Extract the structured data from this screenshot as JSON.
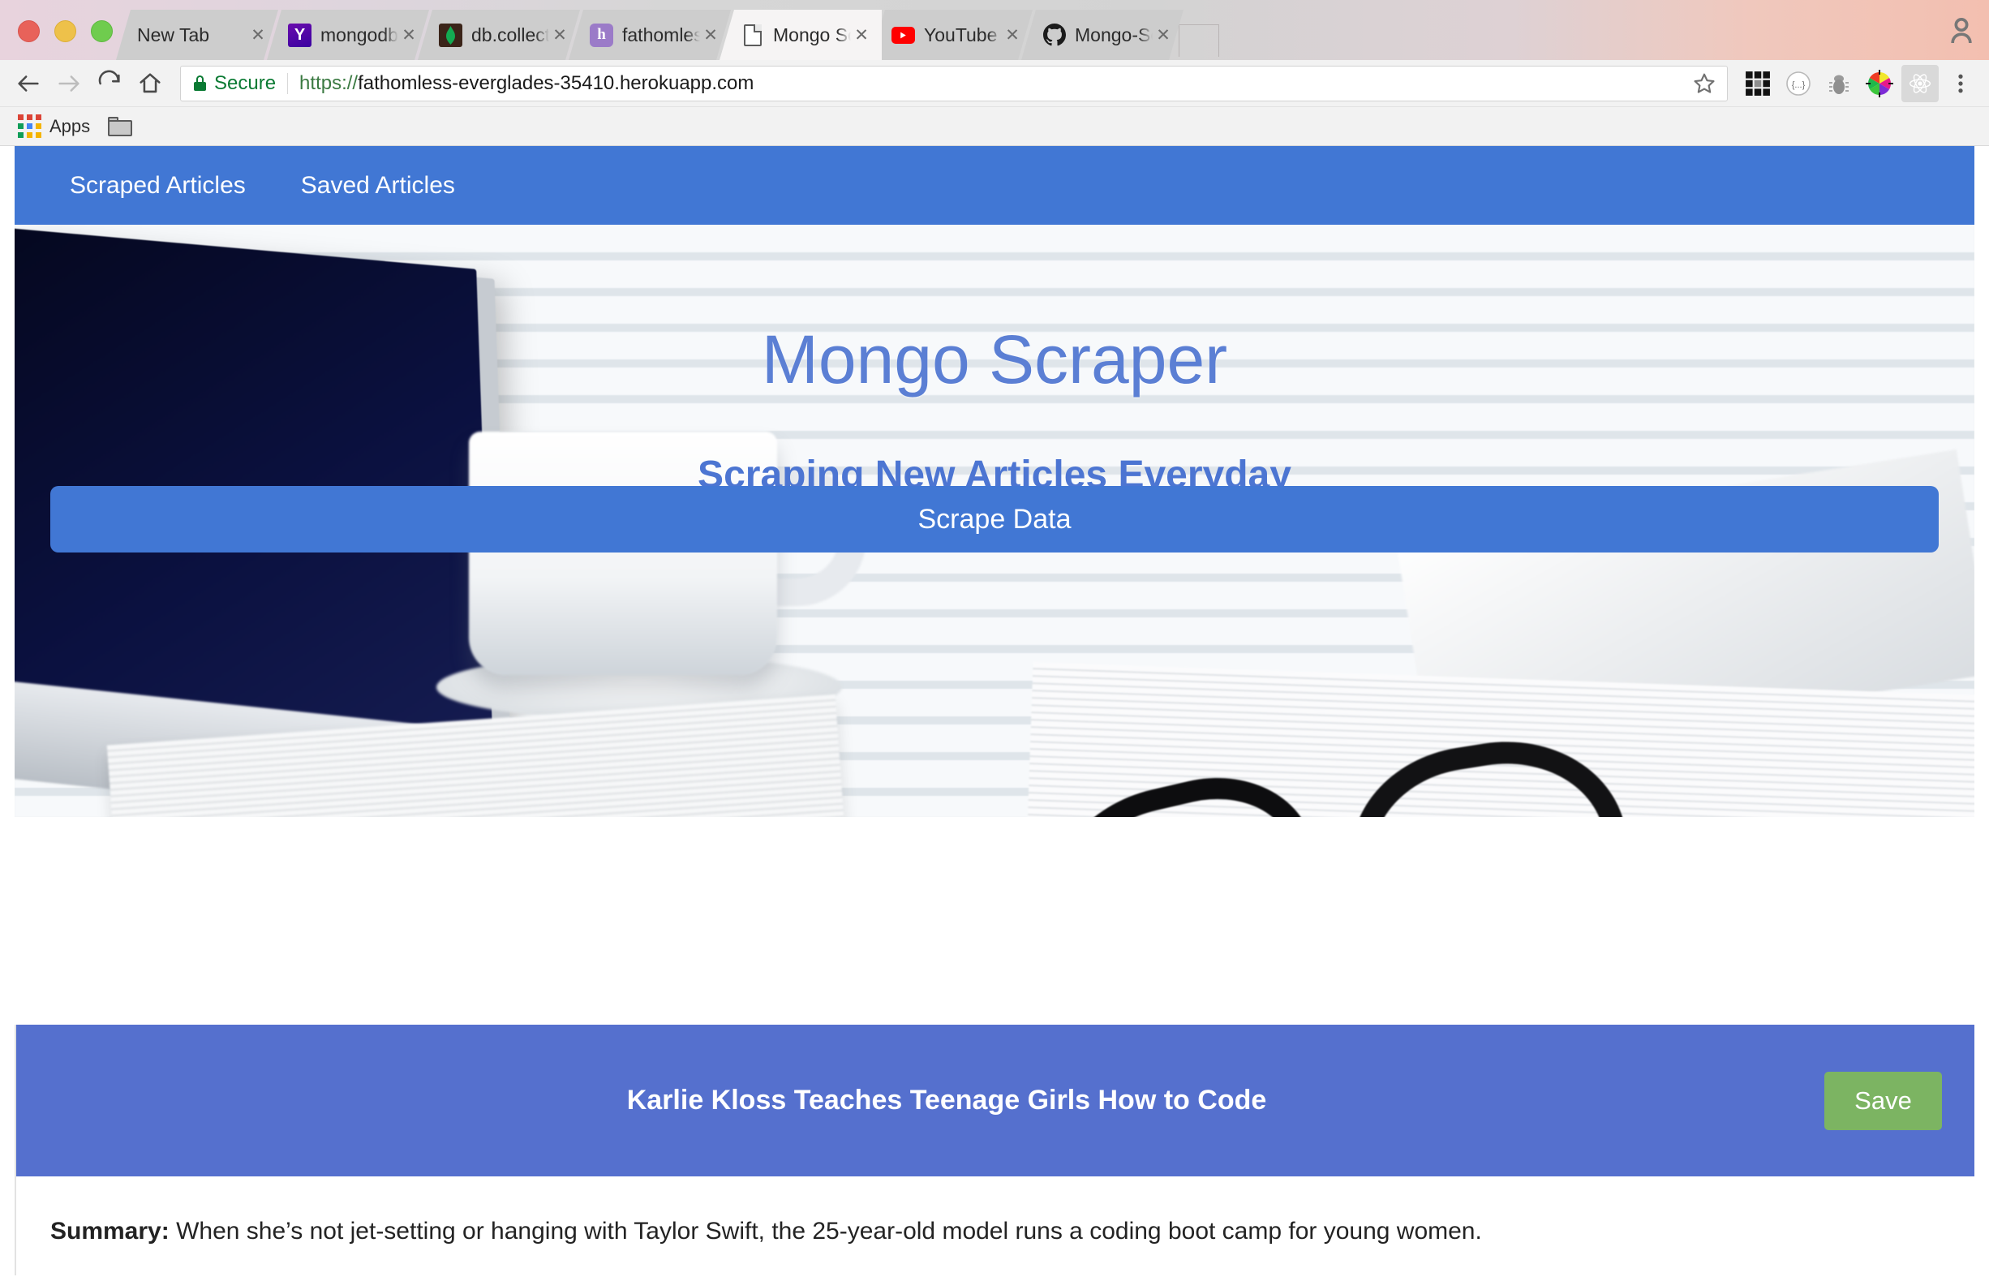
{
  "window": {
    "traffic_lights": [
      "close",
      "minimize",
      "zoom"
    ]
  },
  "tabs": [
    {
      "title": "New Tab",
      "favicon": "blank-page-icon",
      "active": false,
      "close": "✕"
    },
    {
      "title": "mongodb findOne",
      "favicon": "hackernews-icon",
      "favicon_letter": "Y",
      "active": false,
      "close": "✕"
    },
    {
      "title": "db.collection.find(",
      "favicon": "mongodb-leaf-icon",
      "active": false,
      "close": "✕"
    },
    {
      "title": "fathomless-evergl",
      "favicon": "heroku-icon",
      "favicon_letter": "h",
      "active": false,
      "close": "✕"
    },
    {
      "title": "Mongo Scraper",
      "favicon": "document-icon",
      "active": true,
      "close": "✕"
    },
    {
      "title": "YouTube",
      "favicon": "youtube-icon",
      "active": false,
      "close": "✕"
    },
    {
      "title": "Mongo-Scraper/in",
      "favicon": "github-icon",
      "active": false,
      "close": "✕"
    }
  ],
  "toolbar": {
    "back_icon": "back-arrow-icon",
    "forward_icon": "forward-arrow-icon",
    "reload_icon": "reload-icon",
    "home_icon": "home-icon",
    "security_label": "Secure",
    "url_scheme": "https://",
    "url_host": "fathomless-everglades-35410.herokuapp.com",
    "url_full": "https://fathomless-everglades-35410.herokuapp.com",
    "bookmark_icon": "star-icon",
    "extensions": [
      "grid-extension-icon",
      "json-viewer-icon",
      "bug-debugger-icon",
      "color-picker-icon",
      "react-devtools-icon"
    ],
    "menu_icon": "three-dot-menu-icon"
  },
  "bookmarks": {
    "apps_label": "Apps",
    "apps_icon": "apps-grid-icon",
    "folder_icon": "folder-icon"
  },
  "page": {
    "nav": {
      "links": [
        {
          "label": "Scraped Articles"
        },
        {
          "label": "Saved Articles"
        }
      ]
    },
    "hero": {
      "title": "Mongo Scraper",
      "subtitle": "Scraping New Articles Everyday",
      "button_label": "Scrape Data",
      "background_image": "desk-with-laptop-coffee-newspaper-and-glasses"
    },
    "articles": [
      {
        "title": "Karlie Kloss Teaches Teenage Girls How to Code",
        "save_label": "Save",
        "summary_label": "Summary:",
        "summary_text": "When she’s not jet-setting or hanging with Taylor Swift, the 25-year-old model runs a coding boot camp for young women."
      }
    ]
  },
  "colors": {
    "nav_blue": "#4177d4",
    "card_blue": "#5570ce",
    "hero_text_blue": "#5b7fd4",
    "save_green": "#7cb462",
    "secure_green": "#0a7a33"
  }
}
